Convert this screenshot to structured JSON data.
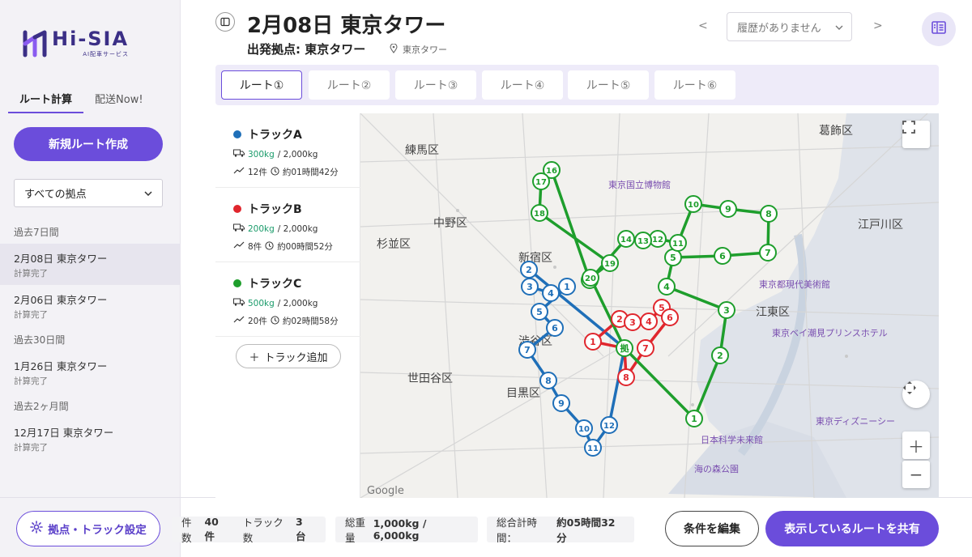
{
  "app": {
    "logo_title": "Hi-SIA",
    "logo_sub": "AI配車サービス"
  },
  "sidebar": {
    "tabs": [
      {
        "label": "ルート計算"
      },
      {
        "label": "配送Now!"
      }
    ],
    "new_route_label": "新規ルート作成",
    "base_select_value": "すべての拠点",
    "groups": [
      {
        "label": "過去7日間"
      },
      {
        "label": "過去30日間"
      },
      {
        "label": "過去2ヶ月間"
      }
    ],
    "history": [
      {
        "title": "2月08日 東京タワー",
        "status": "計算完了"
      },
      {
        "title": "2月06日 東京タワー",
        "status": "計算完了"
      },
      {
        "title": "1月26日 東京タワー",
        "status": "計算完了"
      },
      {
        "title": "12月17日 東京タワー",
        "status": "計算完了"
      }
    ],
    "settings_label": "拠点・トラック設定"
  },
  "header": {
    "title": "2月08日 東京タワー",
    "subtitle": "出発拠点: 東京タワー",
    "location": "東京タワー",
    "nav_prev": "<",
    "nav_next": ">",
    "history_placeholder": "履歴がありません"
  },
  "route_tabs": [
    {
      "label": "ルート①"
    },
    {
      "label": "ルート②"
    },
    {
      "label": "ルート③"
    },
    {
      "label": "ルート④"
    },
    {
      "label": "ルート⑤"
    },
    {
      "label": "ルート⑥"
    }
  ],
  "trucks": [
    {
      "name": "トラックA",
      "color": "#1f6fb8",
      "load": "300kg",
      "capacity": "/ 2,000kg",
      "count": "12件",
      "time": "約01時間42分"
    },
    {
      "name": "トラックB",
      "color": "#e0262d",
      "load": "200kg",
      "capacity": "/ 2,000kg",
      "count": "8件",
      "time": "約00時間52分"
    },
    {
      "name": "トラックC",
      "color": "#1e9e2c",
      "load": "500kg",
      "capacity": "/ 2,000kg",
      "count": "20件",
      "time": "約02時間58分"
    }
  ],
  "add_truck_label": "トラック追加",
  "map": {
    "labels": [
      {
        "text": "練馬区"
      },
      {
        "text": "葛飾区"
      },
      {
        "text": "中野区"
      },
      {
        "text": "杉並区"
      },
      {
        "text": "新宿区"
      },
      {
        "text": "江戸川区"
      },
      {
        "text": "江東区"
      },
      {
        "text": "渋谷区"
      },
      {
        "text": "世田谷区"
      },
      {
        "text": "目黒区"
      },
      {
        "text": "東京国立博物館"
      },
      {
        "text": "東京都現代美術館"
      },
      {
        "text": "東京ディズニーシー"
      },
      {
        "text": "日本科学未来館"
      },
      {
        "text": "海の森公園"
      },
      {
        "text": "東京ベイ潮見プリンスホテル"
      }
    ],
    "depot_label": "拠",
    "google": "Google",
    "routes": [
      {
        "truck": "A",
        "color": "#1f6fb8",
        "stops": [
          "2",
          "3",
          "4",
          "1",
          "5",
          "6",
          "7",
          "8",
          "9",
          "10",
          "11",
          "12"
        ]
      },
      {
        "truck": "B",
        "color": "#e0262d",
        "stops": [
          "1",
          "2",
          "3",
          "4",
          "5",
          "6",
          "7",
          "8"
        ]
      },
      {
        "truck": "C",
        "color": "#1e9e2c",
        "stops": [
          "1",
          "2",
          "3",
          "4",
          "5",
          "6",
          "7",
          "8",
          "9",
          "10",
          "11",
          "12",
          "13",
          "14",
          "15",
          "16",
          "17",
          "18",
          "19",
          "20"
        ]
      }
    ]
  },
  "bottom": {
    "stats": [
      {
        "label": "件数",
        "value": "40 件"
      },
      {
        "label": "トラック数",
        "value": "3 台"
      },
      {
        "label": "総重量",
        "value": "1,000kg / 6,000kg"
      },
      {
        "label": "総合計時間：",
        "value": "約05時間32分"
      }
    ],
    "edit_label": "条件を編集",
    "share_label": "表示しているルートを共有"
  }
}
